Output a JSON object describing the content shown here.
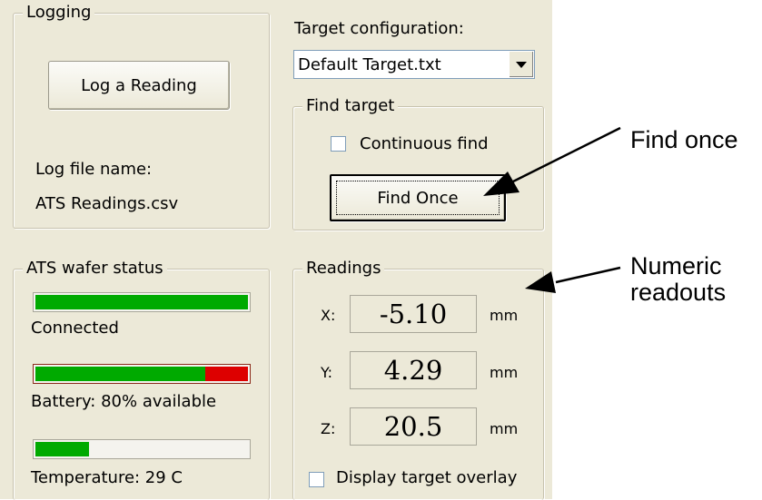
{
  "logging": {
    "legend": "Logging",
    "log_button": "Log a Reading",
    "file_label": "Log file name:",
    "file_name": "ATS Readings.csv"
  },
  "target_configuration": {
    "label": "Target configuration:",
    "selected": "Default Target.txt"
  },
  "find_target": {
    "legend": "Find target",
    "continuous_label": "Continuous find",
    "continuous_checked": false,
    "find_once_button": "Find Once"
  },
  "wafer_status": {
    "legend": "ATS wafer status",
    "connection": {
      "label": "Connected",
      "level": 1.0
    },
    "battery": {
      "label": "Battery: 80% available",
      "level": 0.8
    },
    "temperature": {
      "label": "Temperature: 29 C",
      "level": 0.25
    }
  },
  "readings": {
    "legend": "Readings",
    "rows": [
      {
        "axis": "X:",
        "value": "-5.10",
        "unit": "mm"
      },
      {
        "axis": "Y:",
        "value": "4.29",
        "unit": "mm"
      },
      {
        "axis": "Z:",
        "value": "20.5",
        "unit": "mm"
      }
    ],
    "overlay_label": "Display target overlay",
    "overlay_checked": false
  },
  "annotations": {
    "find_once": "Find once",
    "numeric_line1": "Numeric",
    "numeric_line2": "readouts"
  },
  "colors": {
    "panel": "#ece9d8",
    "bar_good": "#00aa00",
    "bar_bad": "#dd0000",
    "input_border": "#7f9db9"
  }
}
